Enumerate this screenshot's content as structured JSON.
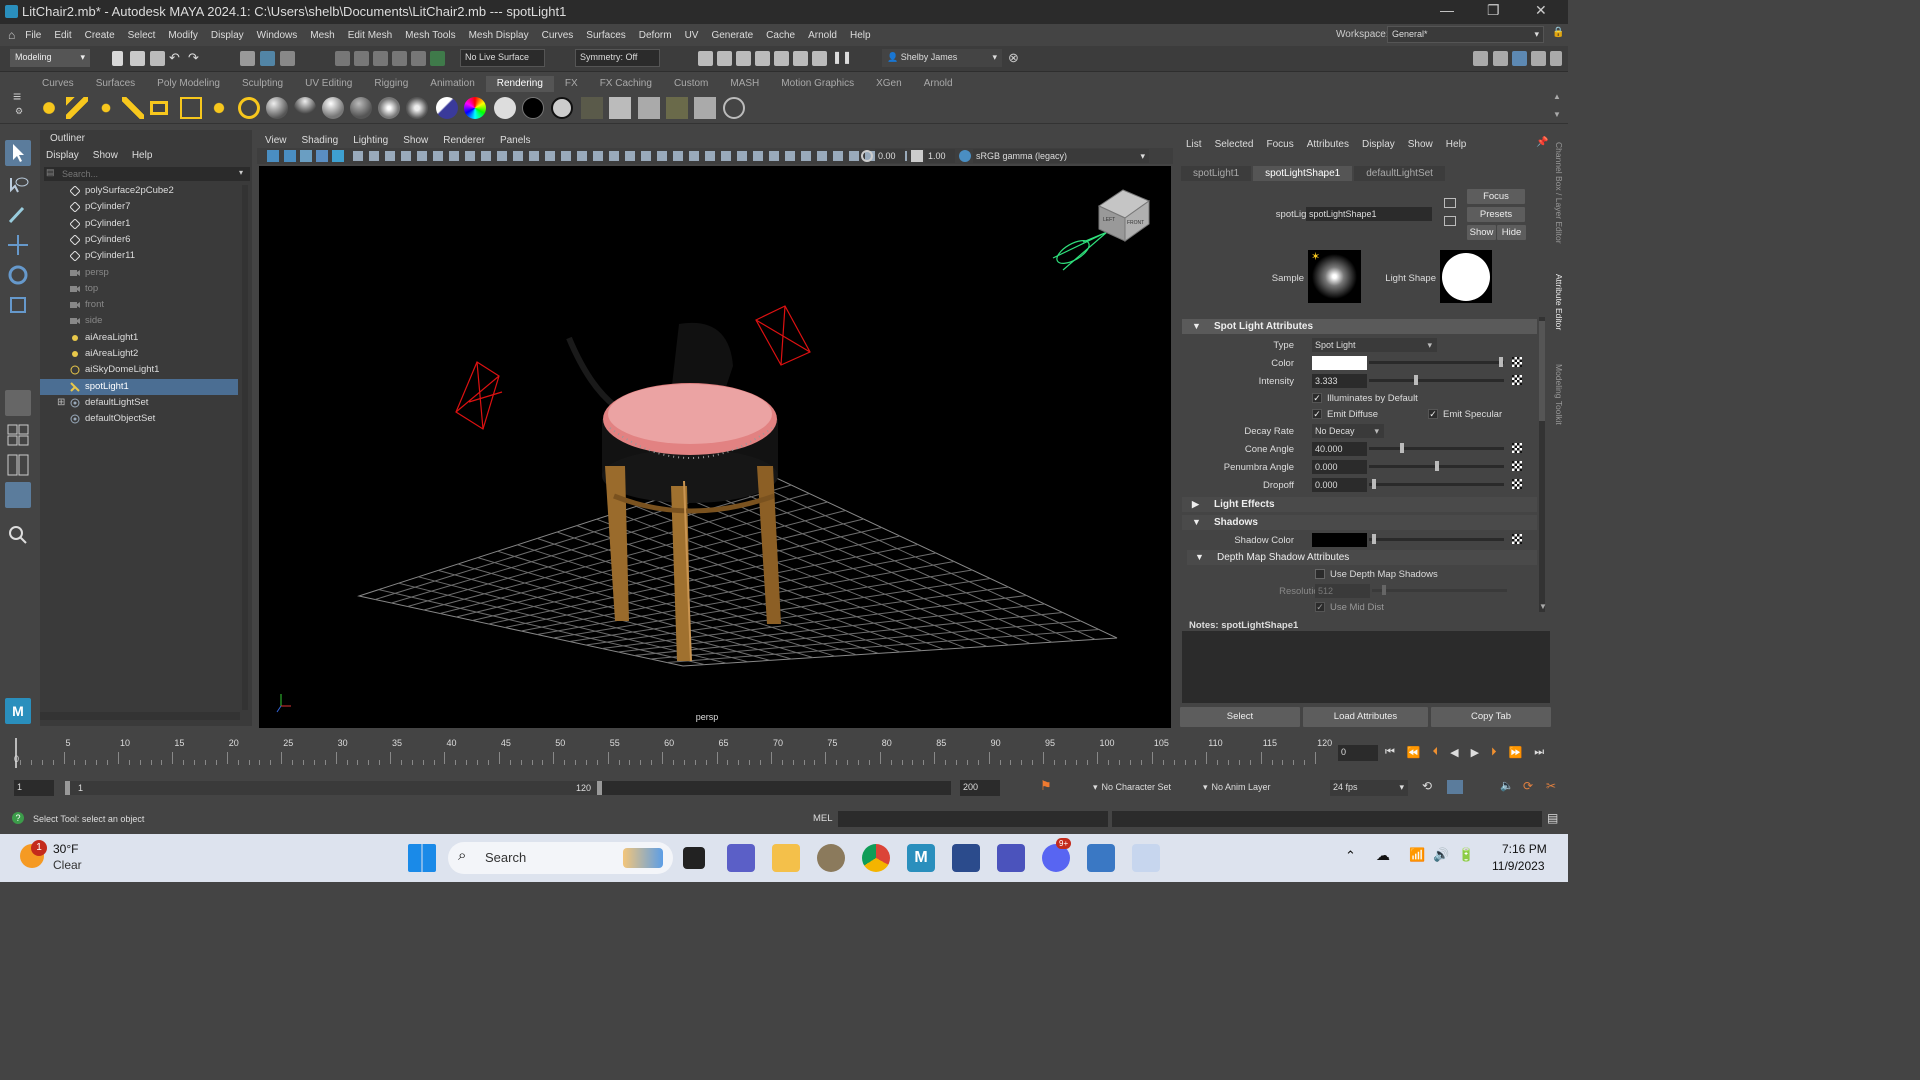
{
  "window": {
    "title": "LitChair2.mb* - Autodesk MAYA 2024.1: C:\\Users\\shelb\\Documents\\LitChair2.mb   ---   spotLight1"
  },
  "menubar": [
    "File",
    "Edit",
    "Create",
    "Select",
    "Modify",
    "Display",
    "Windows",
    "Mesh",
    "Edit Mesh",
    "Mesh Tools",
    "Mesh Display",
    "Curves",
    "Surfaces",
    "Deform",
    "UV",
    "Generate",
    "Cache",
    "Arnold",
    "Help"
  ],
  "workspace": {
    "label": "Workspace:",
    "value": "General*"
  },
  "statusline": {
    "menuset": "Modeling",
    "live_surface": "No Live Surface",
    "symmetry": "Symmetry: Off",
    "user": "Shelby James"
  },
  "shelf_tabs": [
    "Curves",
    "Surfaces",
    "Poly Modeling",
    "Sculpting",
    "UV Editing",
    "Rigging",
    "Animation",
    "Rendering",
    "FX",
    "FX Caching",
    "Custom",
    "MASH",
    "Motion Graphics",
    "XGen",
    "Arnold"
  ],
  "shelf_active": "Rendering",
  "outliner": {
    "title": "Outliner",
    "menu": [
      "Display",
      "Show",
      "Help"
    ],
    "search_placeholder": "Search...",
    "items": [
      {
        "label": "polySurface2pCube2",
        "icon": "mesh-icon",
        "dim": false,
        "sel": false
      },
      {
        "label": "pCylinder7",
        "icon": "mesh-icon",
        "dim": false,
        "sel": false
      },
      {
        "label": "pCylinder1",
        "icon": "mesh-icon",
        "dim": false,
        "sel": false
      },
      {
        "label": "pCylinder6",
        "icon": "mesh-icon",
        "dim": false,
        "sel": false
      },
      {
        "label": "pCylinder11",
        "icon": "mesh-icon",
        "dim": false,
        "sel": false
      },
      {
        "label": "persp",
        "icon": "camera-icon",
        "dim": true,
        "sel": false
      },
      {
        "label": "top",
        "icon": "camera-icon",
        "dim": true,
        "sel": false
      },
      {
        "label": "front",
        "icon": "camera-icon",
        "dim": true,
        "sel": false
      },
      {
        "label": "side",
        "icon": "camera-icon",
        "dim": true,
        "sel": false
      },
      {
        "label": "aiAreaLight1",
        "icon": "area-light-icon",
        "dim": false,
        "sel": false
      },
      {
        "label": "aiAreaLight2",
        "icon": "area-light-icon",
        "dim": false,
        "sel": false
      },
      {
        "label": "aiSkyDomeLight1",
        "icon": "skydome-icon",
        "dim": false,
        "sel": false
      },
      {
        "label": "spotLight1",
        "icon": "spot-light-icon",
        "dim": false,
        "sel": true
      },
      {
        "label": "defaultLightSet",
        "icon": "set-icon",
        "dim": false,
        "sel": false
      },
      {
        "label": "defaultObjectSet",
        "icon": "set-icon",
        "dim": false,
        "sel": false
      }
    ]
  },
  "viewport": {
    "menu": [
      "View",
      "Shading",
      "Lighting",
      "Show",
      "Renderer",
      "Panels"
    ],
    "exposure": "0.00",
    "gamma": "1.00",
    "colorspace": "sRGB gamma (legacy)",
    "camera": "persp",
    "cube_left": "LEFT",
    "cube_front": "FRONT"
  },
  "attr": {
    "menu": [
      "List",
      "Selected",
      "Focus",
      "Attributes",
      "Display",
      "Show",
      "Help"
    ],
    "tabs": [
      "spotLight1",
      "spotLightShape1",
      "defaultLightSet"
    ],
    "active_tab": "spotLightShape1",
    "node_label": "spotLight:",
    "node_value": "spotLightShape1",
    "focus": "Focus",
    "presets": "Presets",
    "show": "Show",
    "hide": "Hide",
    "sample_label": "Sample",
    "lightshape_label": "Light Shape",
    "section_spot": "Spot Light Attributes",
    "type_label": "Type",
    "type_value": "Spot Light",
    "color_label": "Color",
    "intensity_label": "Intensity",
    "intensity_value": "3.333",
    "illum": "Illuminates by Default",
    "emit_diffuse": "Emit Diffuse",
    "emit_specular": "Emit Specular",
    "decay_label": "Decay Rate",
    "decay_value": "No Decay",
    "cone_label": "Cone Angle",
    "cone_value": "40.000",
    "penumbra_label": "Penumbra Angle",
    "penumbra_value": "0.000",
    "dropoff_label": "Dropoff",
    "dropoff_value": "0.000",
    "section_effects": "Light Effects",
    "section_shadows": "Shadows",
    "shadow_color_label": "Shadow Color",
    "section_depth": "Depth Map Shadow Attributes",
    "use_depth": "Use Depth Map Shadows",
    "resolution_label": "Resolution",
    "resolution_value": "512",
    "use_mid": "Use Mid Dist",
    "notes_label": "Notes:",
    "notes_value": "spotLightShape1",
    "btn_select": "Select",
    "btn_load": "Load Attributes",
    "btn_copy": "Copy Tab"
  },
  "side_tabs": [
    "Channel Box / Layer Editor",
    "Attribute Editor",
    "Modeling Toolkit"
  ],
  "timeline": {
    "ticks": [
      "5",
      "10",
      "15",
      "20",
      "25",
      "30",
      "35",
      "40",
      "45",
      "50",
      "55",
      "60",
      "65",
      "70",
      "75",
      "80",
      "85",
      "90",
      "95",
      "100",
      "105",
      "110",
      "115",
      "120"
    ],
    "start": "0",
    "current": "0"
  },
  "range": {
    "start": "1",
    "inner_start": "1",
    "inner_end": "120",
    "end": "200",
    "char_set": "No Character Set",
    "anim_layer": "No Anim Layer",
    "fps": "24 fps"
  },
  "help_line": {
    "text": "Select Tool: select an object",
    "mel": "MEL"
  },
  "taskbar": {
    "temp": "30°F",
    "weather": "Clear",
    "badge": "1",
    "search": "Search",
    "time": "7:16 PM",
    "date": "11/9/2023",
    "discord_badge": "9+"
  }
}
